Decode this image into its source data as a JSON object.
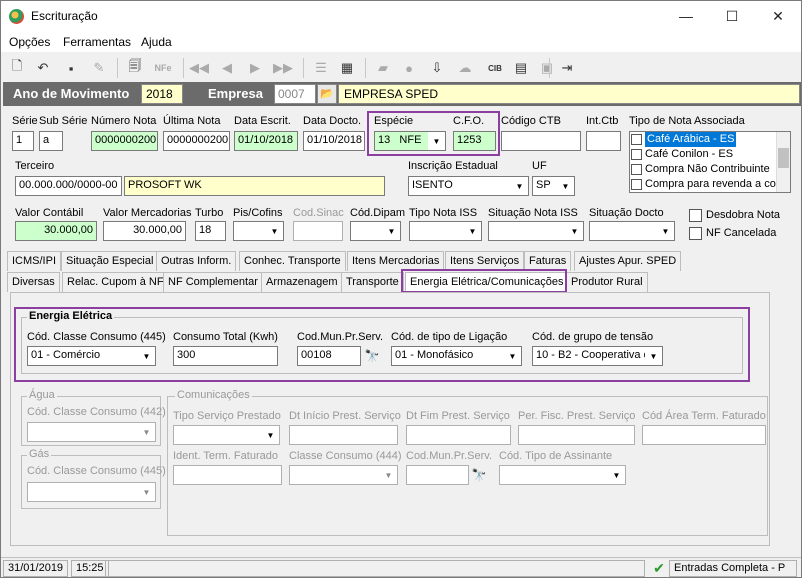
{
  "window": {
    "title": "Escrituração",
    "minimize": "—",
    "maximize": "☐",
    "close": "✕"
  },
  "menu": {
    "items": [
      "Opções",
      "Ferramentas",
      "Ajuda"
    ]
  },
  "toolbar": {
    "icons": [
      "new-icon",
      "undo-icon",
      "save-icon",
      "eraser-icon",
      "preview-icon",
      "nfe-icon",
      "first-icon",
      "prev-icon",
      "next-icon",
      "last-icon",
      "list-icon",
      "report-icon",
      "import-icon",
      "export-icon",
      "folder-icon",
      "apple-icon",
      "calendar-icon",
      "cloud-icon",
      "cib-icon",
      "database-icon",
      "exit-icon"
    ]
  },
  "header": {
    "year_label": "Ano de Movimento",
    "year_value": "2018",
    "company_label": "Empresa",
    "company_code": "0007",
    "company_name": "EMPRESA SPED"
  },
  "row1": {
    "serie_label": "Série",
    "serie_value": "1",
    "subserie_label": "Sub Série",
    "subserie_value": "a",
    "numero_label": "Número Nota",
    "numero_value": "0000000200",
    "ultima_label": "Última Nota",
    "ultima_value": "0000000200",
    "data_escrit_label": "Data Escrit.",
    "data_escrit_value": "01/10/2018",
    "data_docto_label": "Data Docto.",
    "data_docto_value": "01/10/2018",
    "especie_label": "Espécie",
    "especie_value": "13   NFE",
    "cfo_label": "C.F.O.",
    "cfo_value": "1253",
    "codigo_ctb_label": "Código CTB",
    "codigo_ctb_value": "",
    "int_ctb_label": "Int.Ctb",
    "int_ctb_value": "",
    "tipo_nota_label": "Tipo de Nota Associada",
    "tipo_nota_items": [
      "Café Arábica - ES",
      "Café Conilon - ES",
      "Compra Não Contribuinte",
      "Compra para revenda a co"
    ]
  },
  "row2": {
    "terceiro_label": "Terceiro",
    "terceiro_code": "00.000.000/0000-00",
    "terceiro_name": "PROSOFT WK",
    "insc_label": "Inscrição Estadual",
    "insc_value": "ISENTO",
    "uf_label": "UF",
    "uf_value": "SP"
  },
  "row3": {
    "valor_contabil_label": "Valor Contábil",
    "valor_contabil_value": "30.000,00",
    "valor_merc_label": "Valor Mercadorias",
    "valor_merc_value": "30.000,00",
    "turbo_label": "Turbo",
    "turbo_value": "18",
    "pis_label": "Pis/Cofins",
    "cod_sinac_label": "Cod.Sinac",
    "cod_dipam_label": "Cód.Dipam",
    "tipo_iss_label": "Tipo Nota ISS",
    "sit_iss_label": "Situação Nota ISS",
    "sit_docto_label": "Situação Docto",
    "desdobra_label": "Desdobra Nota",
    "cancelada_label": "NF Cancelada"
  },
  "tabs_row1": [
    "ICMS/IPI",
    "Situação Especial",
    "Outras Inform.",
    "Conhec. Transporte",
    "Itens Mercadorias",
    "Itens Serviços",
    "Faturas",
    "Ajustes Apur. SPED"
  ],
  "tabs_row2": [
    "Diversas",
    "Relac. Cupom à NF",
    "NF Complementar",
    "Armazenagem",
    "Transporte",
    "Energia Elétrica/Comunicações",
    "Produtor Rural"
  ],
  "energia": {
    "title": "Energia Elétrica",
    "classe_label": "Cód. Classe Consumo (445)",
    "classe_value": "01 - Comércio",
    "consumo_label": "Consumo Total (Kwh)",
    "consumo_value": "300",
    "mun_label": "Cod.Mun.Pr.Serv.",
    "mun_value": "00108",
    "ligacao_label": "Cód. de tipo de Ligação",
    "ligacao_value": "01 - Monofásico",
    "tensao_label": "Cód. de grupo de tensão",
    "tensao_value": "10 - B2 - Cooperativa d"
  },
  "agua": {
    "title": "Água",
    "classe_label": "Cód. Classe Consumo (442)"
  },
  "gas": {
    "title": "Gás",
    "classe_label": "Cód. Classe Consumo (445)"
  },
  "comunicacoes": {
    "title": "Comunicações",
    "tipo_serv_label": "Tipo Serviço Prestado",
    "dt_inicio_label": "Dt Início Prest. Serviço",
    "dt_fim_label": "Dt Fim Prest. Serviço",
    "per_fisc_label": "Per. Fisc. Prest. Serviço",
    "area_label": "Cód Área Term. Faturado",
    "ident_label": "Ident. Term. Faturado",
    "classe_label": "Classe Consumo (444)",
    "mun_label": "Cod.Mun.Pr.Serv.",
    "assinante_label": "Cód. Tipo de Assinante"
  },
  "status": {
    "date": "31/01/2019",
    "time": "15:25",
    "mode": "Entradas Completa - P"
  }
}
